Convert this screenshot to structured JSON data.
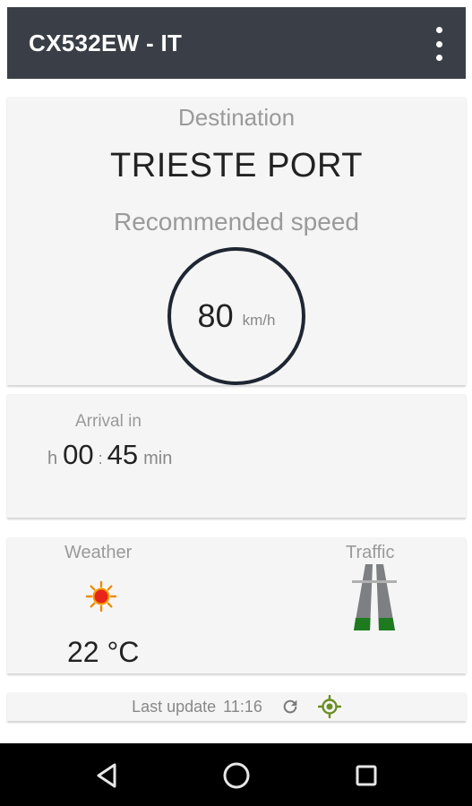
{
  "app_bar": {
    "title": "CX532EW - IT",
    "menu_icon": "more-vert-icon",
    "background_color": "#3a3f47"
  },
  "destination_card": {
    "label": "Destination",
    "value": "TRIESTE PORT",
    "speed_label": "Recommended speed",
    "speed_value": "80",
    "speed_unit": "km/h"
  },
  "arrival_card": {
    "label": "Arrival in",
    "hours_unit": "h",
    "hours": "00",
    "separator": ":",
    "minutes": "45",
    "minutes_unit": "min"
  },
  "conditions_card": {
    "weather_label": "Weather",
    "weather_icon": "sun-icon",
    "temperature": "22 °C",
    "traffic_label": "Traffic",
    "traffic_icon": "road-icon",
    "traffic_color": "#1e7a1e"
  },
  "status_bar": {
    "last_update_label": "Last update",
    "last_update_time": "11:16",
    "refresh_icon": "refresh-icon",
    "locate_icon": "locate-icon",
    "locate_color": "#6b8e23"
  },
  "system_nav": {
    "back_icon": "back-icon",
    "home_icon": "home-icon",
    "recent_icon": "recent-apps-icon"
  }
}
